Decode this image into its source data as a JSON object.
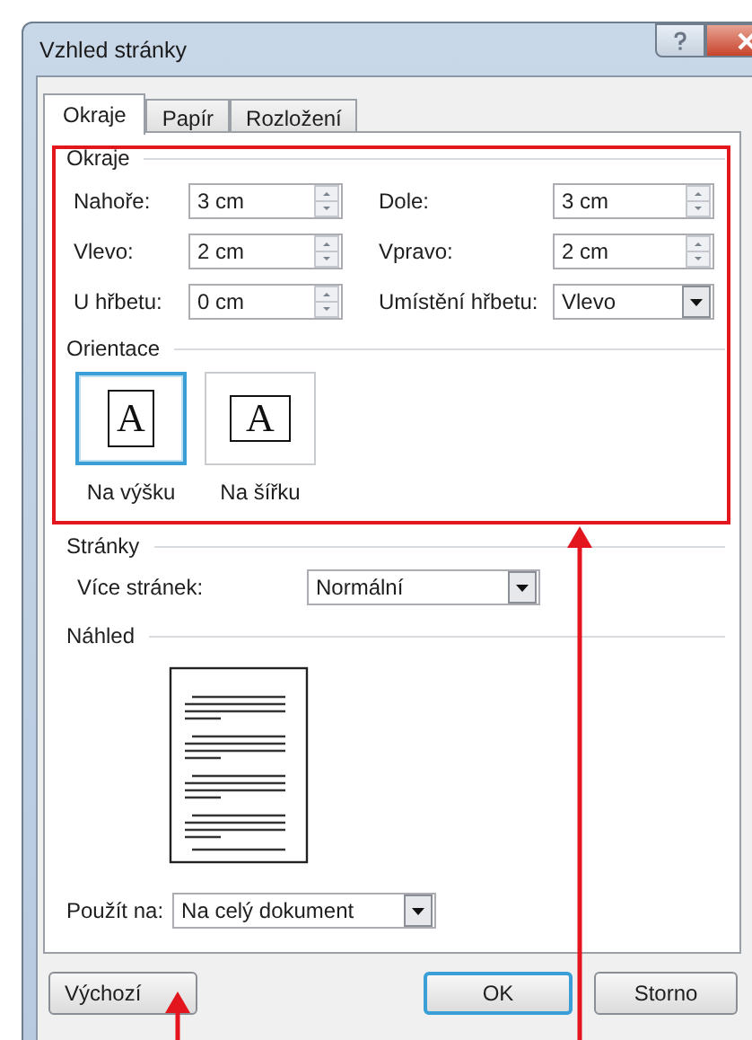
{
  "window": {
    "title": "Vzhled stránky"
  },
  "tabs": [
    {
      "label": "Okraje",
      "selected": true
    },
    {
      "label": "Papír",
      "selected": false
    },
    {
      "label": "Rozložení",
      "selected": false
    }
  ],
  "margins": {
    "title": "Okraje",
    "fields": [
      {
        "label": "Nahoře:",
        "value": "3 cm",
        "kind": "spin"
      },
      {
        "label": "Dole:",
        "value": "3 cm",
        "kind": "spin"
      },
      {
        "label": "Vlevo:",
        "value": "2 cm",
        "kind": "spin"
      },
      {
        "label": "Vpravo:",
        "value": "2 cm",
        "kind": "spin"
      },
      {
        "label": "U hřbetu:",
        "value": "0 cm",
        "kind": "spin"
      },
      {
        "label": "Umístění hřbetu:",
        "value": "Vlevo",
        "kind": "dropdown"
      }
    ]
  },
  "orientation": {
    "title": "Orientace",
    "options": [
      {
        "label": "Na výšku",
        "glyph": "A",
        "kind": "portrait",
        "selected": true
      },
      {
        "label": "Na šířku",
        "glyph": "A",
        "kind": "landscape",
        "selected": false
      }
    ]
  },
  "pages": {
    "title": "Stránky",
    "label": "Více stránek:",
    "value": "Normální"
  },
  "preview": {
    "title": "Náhled"
  },
  "apply_to": {
    "label": "Použít na:",
    "value": "Na celý dokument"
  },
  "buttons": [
    {
      "label": "Výchozí",
      "default": false
    },
    {
      "label": "OK",
      "default": true
    },
    {
      "label": "Storno",
      "default": false
    }
  ]
}
